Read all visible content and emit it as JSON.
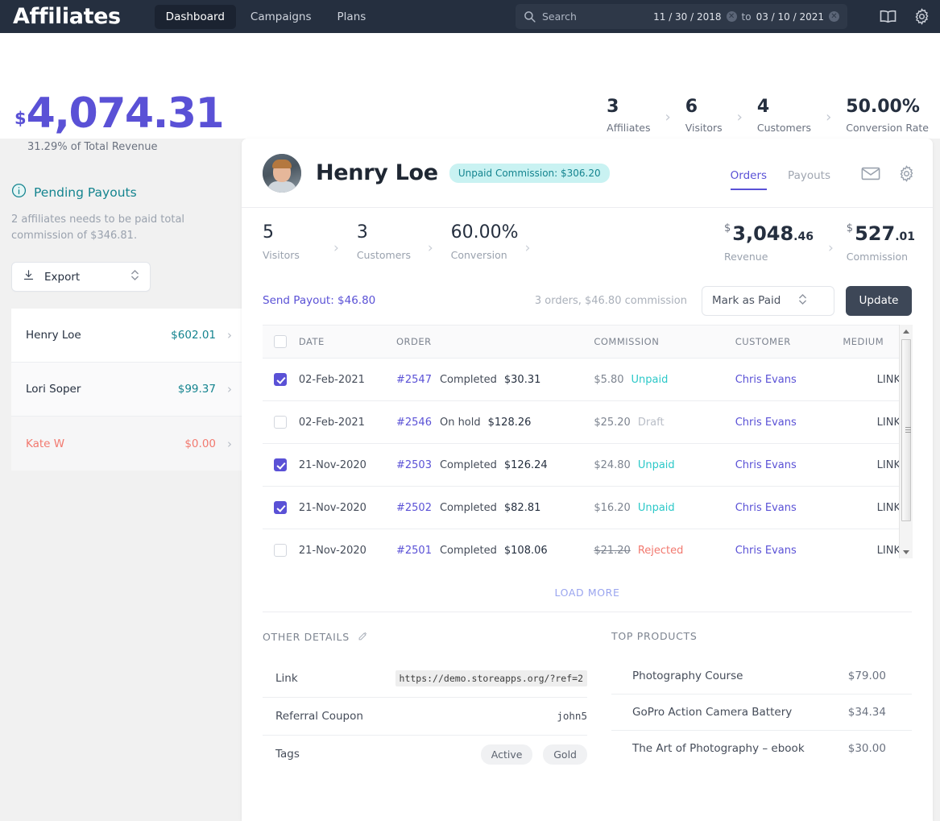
{
  "topnav": {
    "brand": "Affiliates",
    "links": [
      {
        "label": "Dashboard",
        "active": true
      },
      {
        "label": "Campaigns",
        "active": false
      },
      {
        "label": "Plans",
        "active": false
      }
    ],
    "search": {
      "placeholder": "Search",
      "date_from": "11 / 30 / 2018",
      "to_label": "to",
      "date_to": "03 / 10 / 2021"
    },
    "icons": [
      "book-icon",
      "gear-icon"
    ]
  },
  "summary": {
    "currency": "$",
    "total": "4,074.31",
    "subtitle": "31.29% of Total Revenue",
    "kpis": [
      {
        "value": "3",
        "label": "Affiliates"
      },
      {
        "value": "6",
        "label": "Visitors"
      },
      {
        "value": "4",
        "label": "Customers"
      },
      {
        "value": "50.00%",
        "label": "Conversion Rate"
      }
    ]
  },
  "sidebar": {
    "title": "Pending Payouts",
    "description": "2 affiliates needs to be paid total commission of $346.81.",
    "export_label": "Export",
    "payouts": [
      {
        "name": "Henry Loe",
        "amount": "$602.01",
        "muted": false
      },
      {
        "name": "Lori Soper",
        "amount": "$99.37",
        "muted": false
      },
      {
        "name": "Kate W",
        "amount": "$0.00",
        "muted": true
      }
    ]
  },
  "affiliate": {
    "name": "Henry Loe",
    "badge": "Unpaid Commission: $306.20",
    "tabs": [
      {
        "label": "Orders",
        "active": true
      },
      {
        "label": "Payouts",
        "active": false
      }
    ],
    "header_icons": [
      "mail-icon",
      "gear-icon"
    ],
    "stats": [
      {
        "value": "5",
        "label": "Visitors"
      },
      {
        "value": "3",
        "label": "Customers"
      },
      {
        "value": "60.00%",
        "label": "Conversion"
      }
    ],
    "money_stats": [
      {
        "currency": "$",
        "main": "3,048",
        "cents": ".46",
        "label": "Revenue"
      },
      {
        "currency": "$",
        "main": "527",
        "cents": ".01",
        "label": "Commission"
      }
    ]
  },
  "payout_action": {
    "send_payout": "Send Payout: $46.80",
    "order_summary": "3 orders, $46.80 commission",
    "select_value": "Mark as Paid",
    "update_label": "Update"
  },
  "orders_table": {
    "columns": [
      "DATE",
      "ORDER",
      "COMMISSION",
      "CUSTOMER",
      "MEDIUM"
    ],
    "rows": [
      {
        "checked": true,
        "date": "02-Feb-2021",
        "order_no": "#2547",
        "order_status": "Completed",
        "order_amount": "$30.31",
        "commission": "$5.80",
        "commission_strike": false,
        "status": "Unpaid",
        "status_kind": "unpaid",
        "customer": "Chris Evans",
        "medium": "LINK"
      },
      {
        "checked": false,
        "date": "02-Feb-2021",
        "order_no": "#2546",
        "order_status": "On hold",
        "order_amount": "$128.26",
        "commission": "$25.20",
        "commission_strike": false,
        "status": "Draft",
        "status_kind": "draft",
        "customer": "Chris Evans",
        "medium": "LINK"
      },
      {
        "checked": true,
        "date": "21-Nov-2020",
        "order_no": "#2503",
        "order_status": "Completed",
        "order_amount": "$126.24",
        "commission": "$24.80",
        "commission_strike": false,
        "status": "Unpaid",
        "status_kind": "unpaid",
        "customer": "Chris Evans",
        "medium": "LINK"
      },
      {
        "checked": true,
        "date": "21-Nov-2020",
        "order_no": "#2502",
        "order_status": "Completed",
        "order_amount": "$82.81",
        "commission": "$16.20",
        "commission_strike": false,
        "status": "Unpaid",
        "status_kind": "unpaid",
        "customer": "Chris Evans",
        "medium": "LINK"
      },
      {
        "checked": false,
        "date": "21-Nov-2020",
        "order_no": "#2501",
        "order_status": "Completed",
        "order_amount": "$108.06",
        "commission": "$21.20",
        "commission_strike": true,
        "status": "Rejected",
        "status_kind": "rejected",
        "customer": "Chris Evans",
        "medium": "LINK"
      }
    ],
    "load_more": "LOAD MORE"
  },
  "other_details": {
    "title": "OTHER DETAILS",
    "rows": [
      {
        "key": "Link",
        "value": "https://demo.storeapps.org/?ref=2",
        "kind": "code"
      },
      {
        "key": "Referral Coupon",
        "value": "john5",
        "kind": "mono"
      },
      {
        "key": "Tags",
        "value": "",
        "kind": "tags",
        "tags": [
          "Active",
          "Gold"
        ]
      }
    ]
  },
  "top_products": {
    "title": "TOP PRODUCTS",
    "items": [
      {
        "name": "Photography Course",
        "price": "$79.00"
      },
      {
        "name": "GoPro Action Camera Battery",
        "price": "$34.34"
      },
      {
        "name": "The Art of Photography – ebook",
        "price": "$30.00"
      }
    ]
  }
}
